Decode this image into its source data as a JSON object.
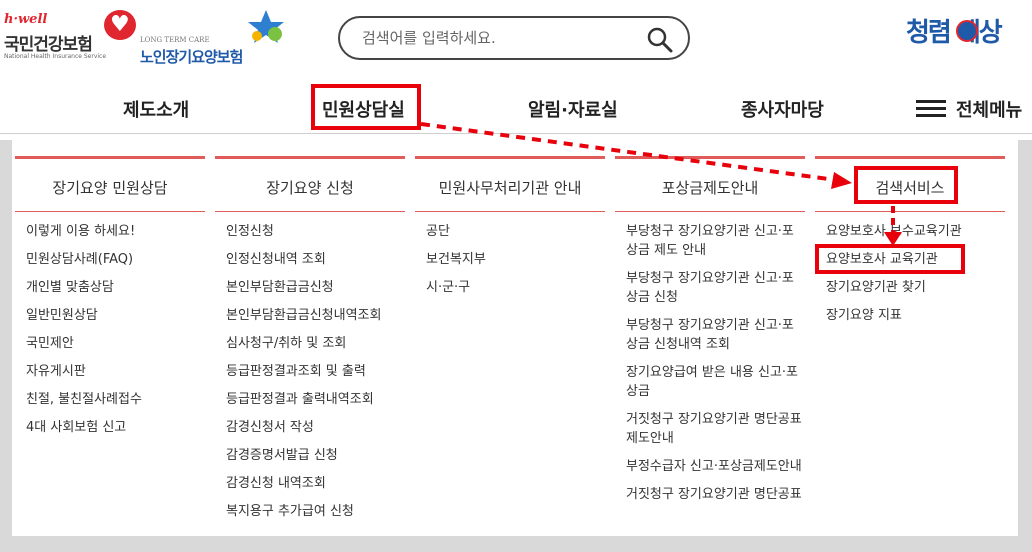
{
  "header": {
    "nhis_logo": {
      "brand": "h·well",
      "name": "국민건강보험",
      "english": "National Health Insurance Service"
    },
    "ltc_logo": {
      "english": "LONG TERM CARE",
      "name": "노인장기요양보험"
    },
    "search": {
      "placeholder": "검색어를 입력하세요.",
      "icon": "search-icon"
    },
    "clean_logo": {
      "text": "청렴 세상",
      "emblem": "韓"
    }
  },
  "gnb": {
    "items": [
      "제도소개",
      "민원상담실",
      "알림·자료실",
      "종사자마당"
    ],
    "active": "민원상담실",
    "all_menu": "전체메뉴"
  },
  "submenu": {
    "columns": [
      {
        "title": "장기요양 민원상담",
        "items": [
          "이렇게 이용 하세요!",
          "민원상담사례(FAQ)",
          "개인별 맞춤상담",
          "일반민원상담",
          "국민제안",
          "자유게시판",
          "친절, 불친절사례접수",
          "4대 사회보험 신고"
        ]
      },
      {
        "title": "장기요양 신청",
        "items": [
          "인정신청",
          "인정신청내역 조회",
          "본인부담환급금신청",
          "본인부담환급금신청내역조회",
          "심사청구/취하 및 조회",
          "등급판정결과조회 및 출력",
          "등급판정결과 출력내역조회",
          "감경신청서 작성",
          "감경증명서발급 신청",
          "감경신청 내역조회",
          "복지용구 추가급여 신청"
        ]
      },
      {
        "title": "민원사무처리기관 안내",
        "items": [
          "공단",
          "보건복지부",
          "시·군·구"
        ]
      },
      {
        "title": "포상금제도안내",
        "items": [
          "부당청구 장기요양기관 신고·포상금 제도 안내",
          "부당청구 장기요양기관 신고·포상금 신청",
          "부당청구 장기요양기관 신고·포상금 신청내역 조회",
          "장기요양급여 받은 내용 신고·포상금",
          "거짓청구 장기요양기관 명단공표제도안내",
          "부정수급자 신고·포상금제도안내",
          "거짓청구 장기요양기관 명단공표"
        ]
      },
      {
        "title": "검색서비스",
        "items": [
          "요양보호사 보수교육기관",
          "요양보호사 교육기관",
          "장기요양기관 찾기",
          "장기요양 지표"
        ]
      }
    ]
  },
  "annotations": {
    "highlight_color": "#e8000b",
    "accent_line_color": "#e25b5b"
  }
}
